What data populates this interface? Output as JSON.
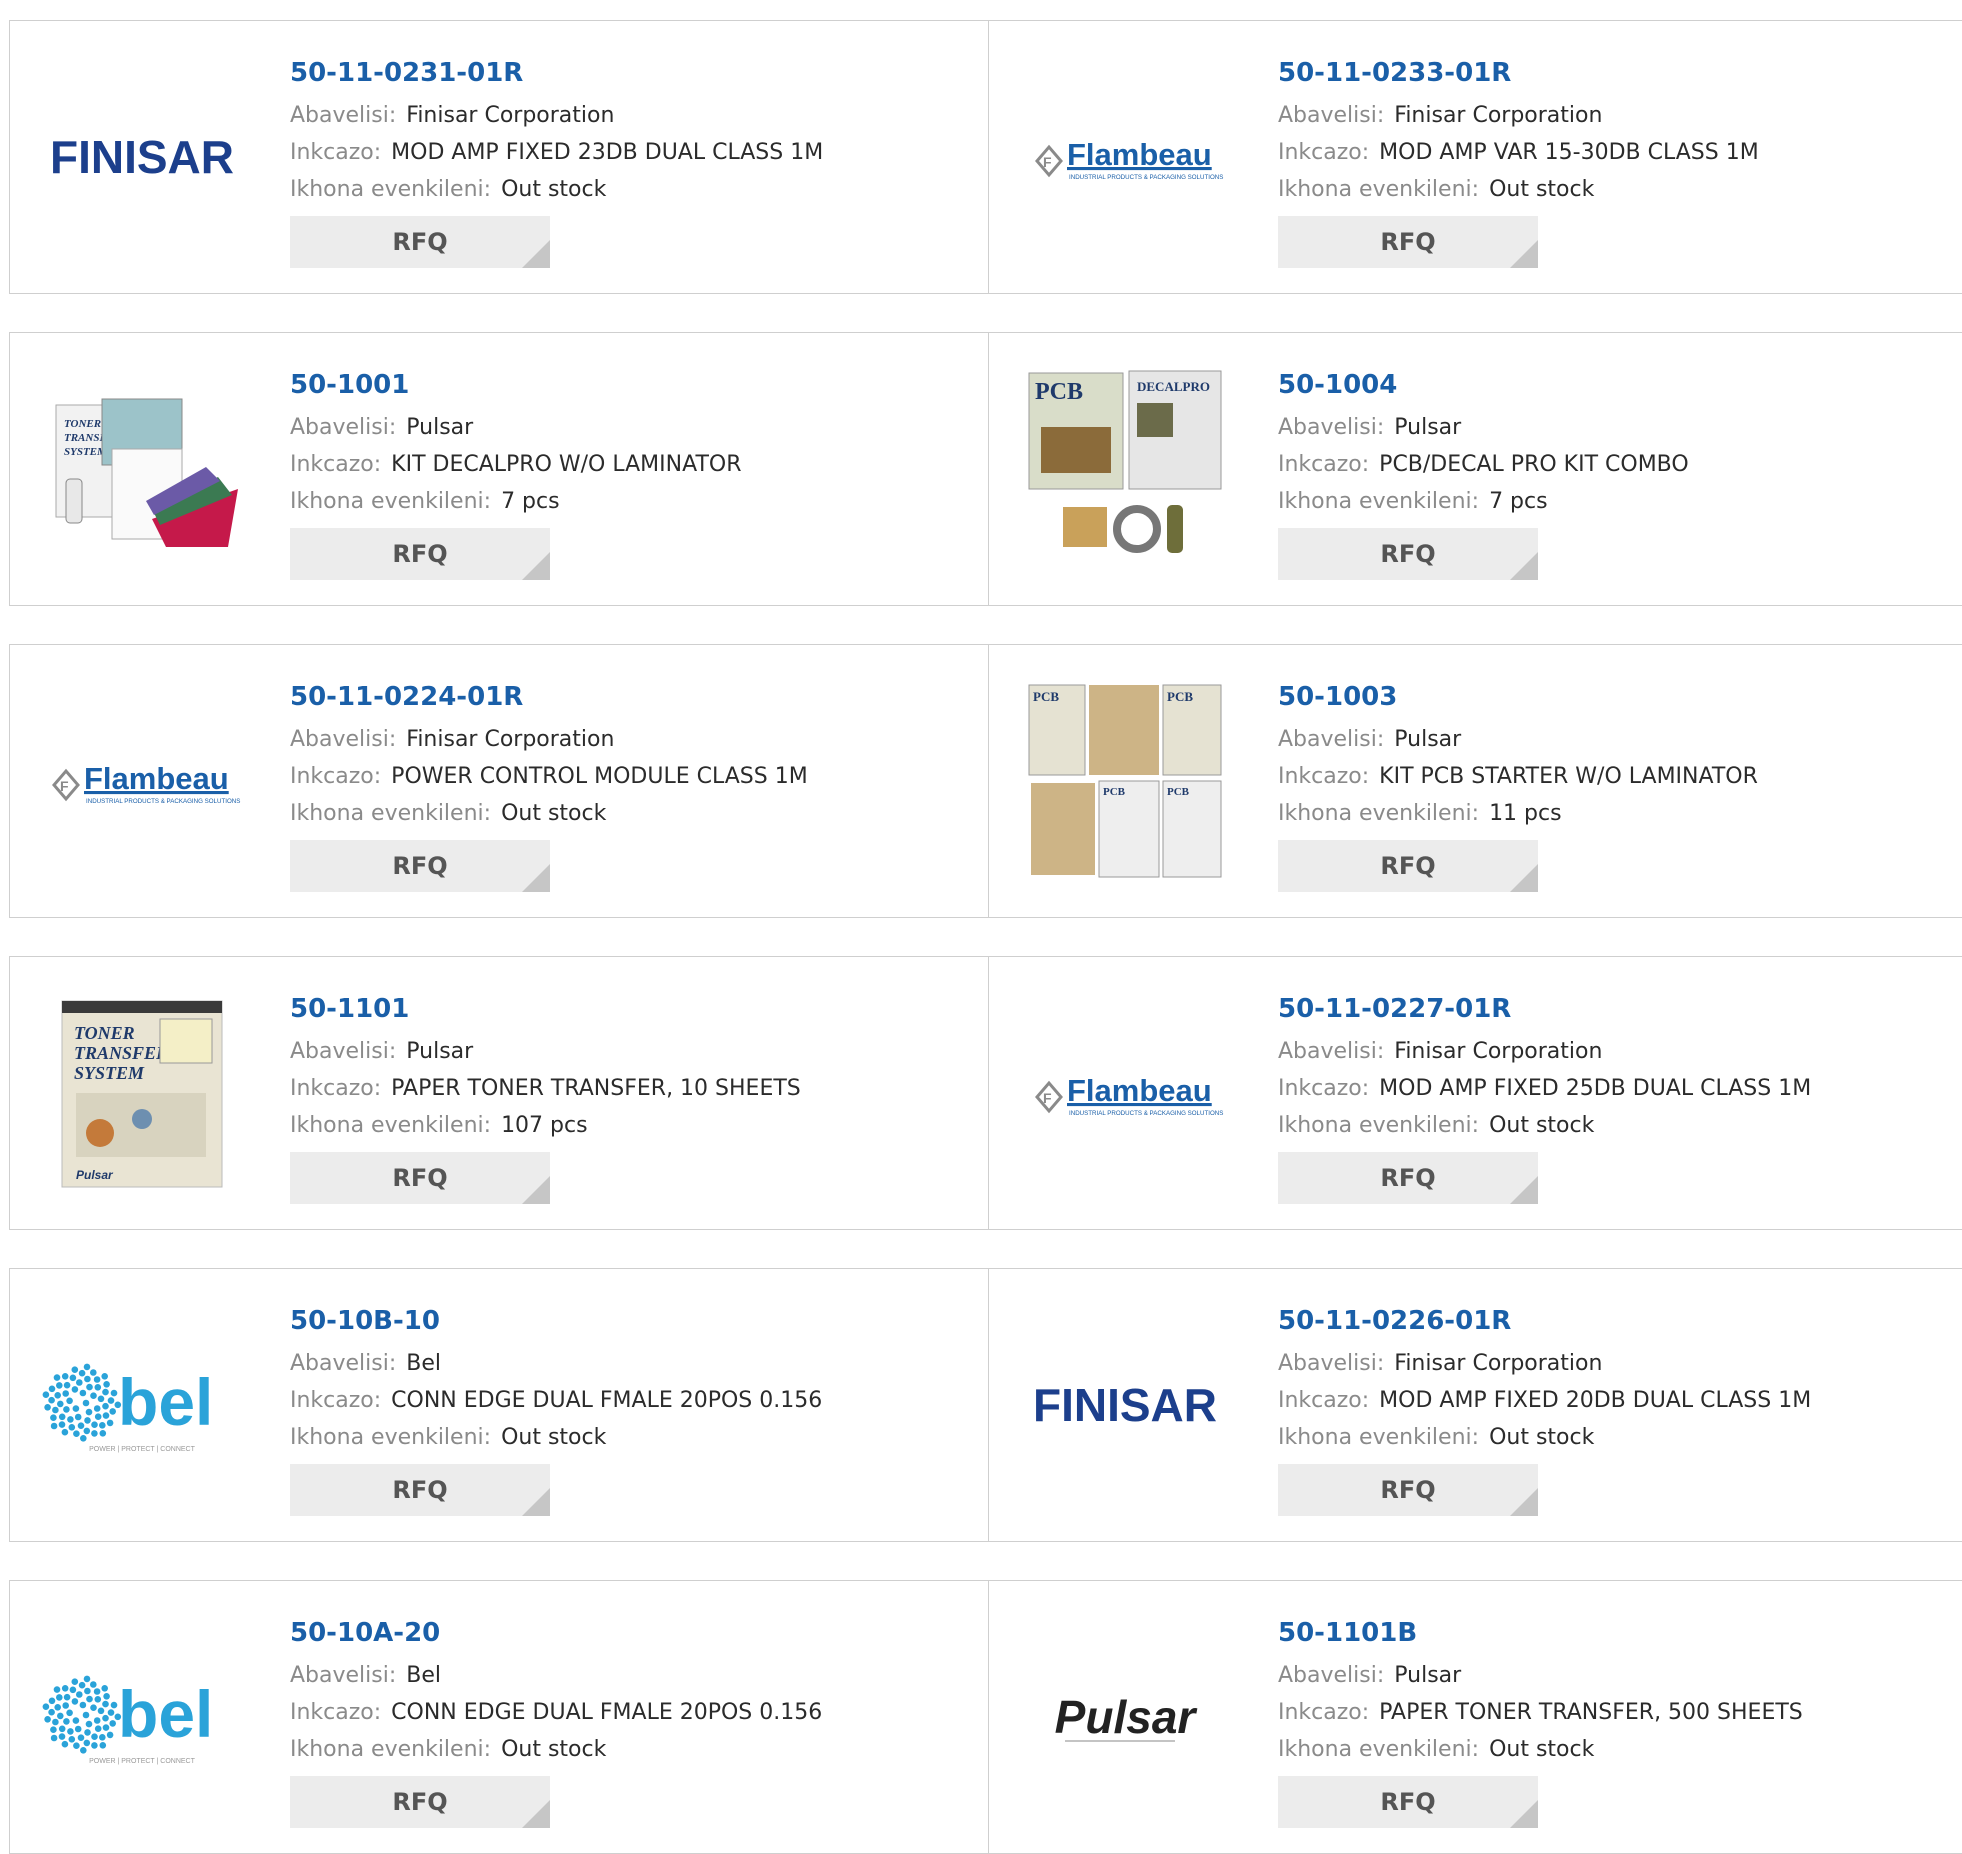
{
  "labels": {
    "manufacturer": "Abavelisi:",
    "description": "Inkcazo:",
    "stock": "Ikhona evenkileni:",
    "rfq": "RFQ"
  },
  "logo_text": {
    "finisar": "FINISAR",
    "flambeau": "Flambeau",
    "flambeau_sub": "INDUSTRIAL PRODUCTS & PACKAGING SOLUTIONS",
    "bel": "bel",
    "bel_sub": "POWER | PROTECT | CONNECT",
    "pulsar": "Pulsar",
    "toner_title": "TONER TRANSFER SYSTEM",
    "pcb_title": "PCB",
    "decal_title": "DECALPRO"
  },
  "colors": {
    "link": "#1a5fa8",
    "finisar": "#1c3f8c",
    "flambeau": "#1a5fa8",
    "bel": "#2aa3d9",
    "border": "#cfcfcf",
    "button_bg": "#ececec"
  },
  "products": [
    {
      "part": "50-11-0231-01R",
      "manufacturer": "Finisar Corporation",
      "description": "MOD AMP FIXED 23DB DUAL CLASS 1M",
      "stock": "Out stock",
      "image": "finisar-logo"
    },
    {
      "part": "50-11-0233-01R",
      "manufacturer": "Finisar Corporation",
      "description": "MOD AMP VAR 15-30DB CLASS 1M",
      "stock": "Out stock",
      "image": "flambeau-logo"
    },
    {
      "part": "50-1001",
      "manufacturer": "Pulsar",
      "description": "KIT DECALPRO W/O LAMINATOR",
      "stock": "7 pcs",
      "image": "decalpro-kit-photo"
    },
    {
      "part": "50-1004",
      "manufacturer": "Pulsar",
      "description": "PCB/DECAL PRO KIT COMBO",
      "stock": "7 pcs",
      "image": "pcb-decal-combo-photo"
    },
    {
      "part": "50-11-0224-01R",
      "manufacturer": "Finisar Corporation",
      "description": "POWER CONTROL MODULE CLASS 1M",
      "stock": "Out stock",
      "image": "flambeau-logo"
    },
    {
      "part": "50-1003",
      "manufacturer": "Pulsar",
      "description": "KIT PCB STARTER W/O LAMINATOR",
      "stock": "11 pcs",
      "image": "pcb-starter-kit-photo"
    },
    {
      "part": "50-1101",
      "manufacturer": "Pulsar",
      "description": "PAPER TONER TRANSFER, 10 SHEETS",
      "stock": "107 pcs",
      "image": "toner-transfer-photo"
    },
    {
      "part": "50-11-0227-01R",
      "manufacturer": "Finisar Corporation",
      "description": "MOD AMP FIXED 25DB DUAL CLASS 1M",
      "stock": "Out stock",
      "image": "flambeau-logo"
    },
    {
      "part": "50-10B-10",
      "manufacturer": "Bel",
      "description": "CONN EDGE DUAL FMALE 20POS 0.156",
      "stock": "Out stock",
      "image": "bel-logo"
    },
    {
      "part": "50-11-0226-01R",
      "manufacturer": "Finisar Corporation",
      "description": "MOD AMP FIXED 20DB DUAL CLASS 1M",
      "stock": "Out stock",
      "image": "finisar-logo"
    },
    {
      "part": "50-10A-20",
      "manufacturer": "Bel",
      "description": "CONN EDGE DUAL FMALE 20POS 0.156",
      "stock": "Out stock",
      "image": "bel-logo"
    },
    {
      "part": "50-1101B",
      "manufacturer": "Pulsar",
      "description": "PAPER TONER TRANSFER, 500 SHEETS",
      "stock": "Out stock",
      "image": "pulsar-logo"
    }
  ]
}
